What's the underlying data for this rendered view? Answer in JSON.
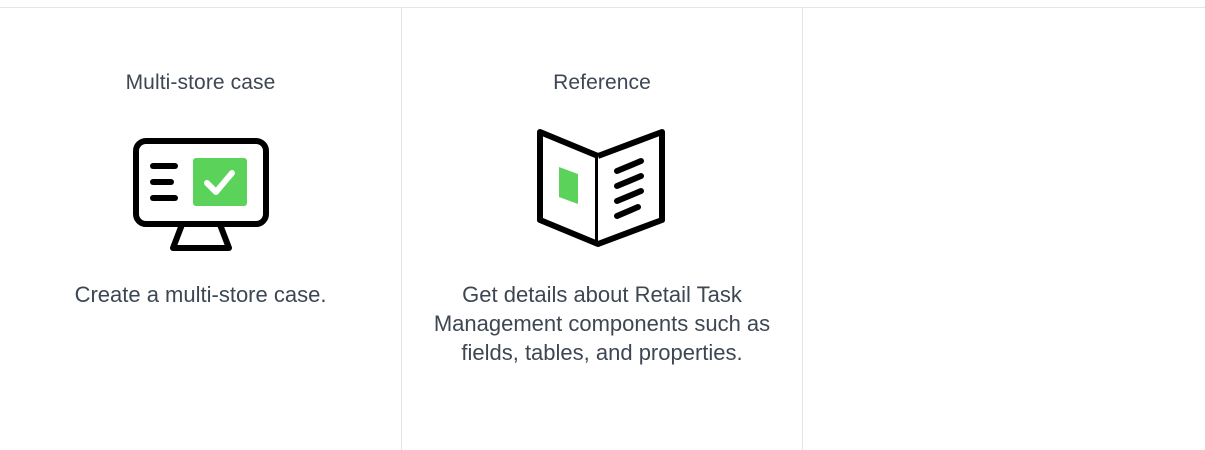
{
  "cards": [
    {
      "title": "Multi-store case",
      "icon": "monitor-check-icon",
      "description": "Create a multi-store case."
    },
    {
      "title": "Reference",
      "icon": "open-book-icon",
      "description": "Get details about Retail Task Management components such as fields, tables, and properties."
    }
  ],
  "colors": {
    "accent_green": "#5bd35a",
    "icon_stroke": "#000000",
    "text": "#3d4753",
    "divider": "#e3e5e8"
  }
}
